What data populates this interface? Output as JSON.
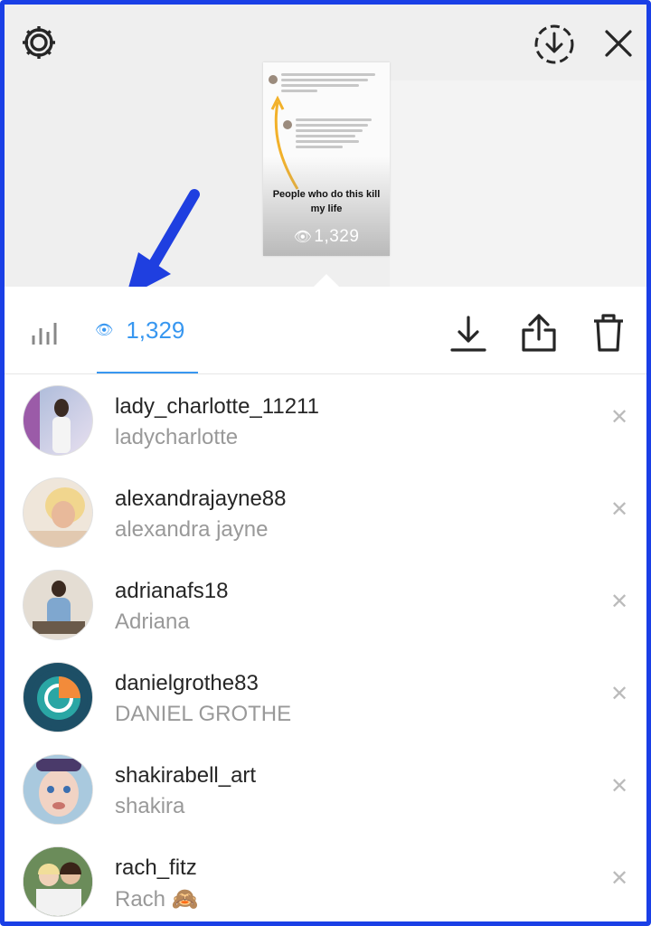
{
  "story": {
    "caption": "People who do this kill my life",
    "views": "1,329"
  },
  "toolbar": {
    "viewer_count": "1,329"
  },
  "viewers": [
    {
      "username": "lady_charlotte_11211",
      "name": "ladycharlotte"
    },
    {
      "username": "alexandrajayne88",
      "name": "alexandra jayne"
    },
    {
      "username": "adrianafs18",
      "name": "Adriana"
    },
    {
      "username": "danielgrothe83",
      "name": "DANIEL GROTHE"
    },
    {
      "username": "shakirabell_art",
      "name": "shakira"
    },
    {
      "username": "rach_fitz",
      "name": "Rach 🙈"
    }
  ],
  "icons": {
    "settings": "gear-icon",
    "save_story": "download-circle-icon",
    "close": "close-icon",
    "insights": "bar-chart-icon",
    "views": "eye-icon",
    "download": "download-icon",
    "share": "share-icon",
    "delete": "trash-icon",
    "remove_viewer": "close-small-icon"
  },
  "colors": {
    "frame_border": "#1a3fe6",
    "accent": "#3897f0",
    "annotation_arrow": "#1f3fe0"
  }
}
